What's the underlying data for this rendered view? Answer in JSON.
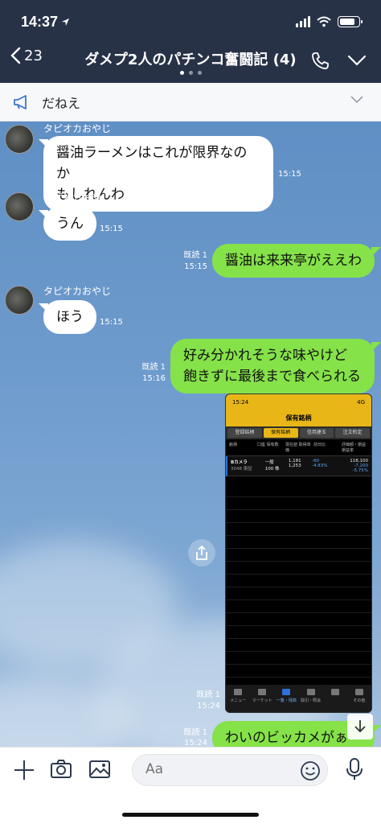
{
  "status": {
    "time": "14:37"
  },
  "header": {
    "back_count": "23",
    "title": "ダメプ2人のパチンコ奮闘記 (4)"
  },
  "announcement": {
    "text": "だねえ"
  },
  "messages": [
    {
      "sender": "タピオカおやじ",
      "text_lines": [
        "醤油ラーメンはこれが限界なのか",
        "もしれんわ"
      ],
      "time": "15:15"
    },
    {
      "sender": "タピオカおやじ",
      "text": "うん",
      "time": "15:15"
    },
    {
      "read": "既読 1",
      "time": "15:15",
      "text": "醤油は来来亭がええわ"
    },
    {
      "sender": "タピオカおやじ",
      "text": "ほう",
      "time": "15:15"
    },
    {
      "read": "既読 1",
      "time": "15:16",
      "text_lines": [
        "好み分かれそうな味やけど",
        "飽きずに最後まで食べられる"
      ]
    },
    {
      "read": "既読 1",
      "time": "15:24"
    },
    {
      "read": "既読 1",
      "time": "15:24",
      "text": "わいのビッカメがぁ"
    }
  ],
  "stock_screenshot": {
    "status_time": "15:24",
    "status_net": "4G",
    "title": "保有銘柄",
    "tabs": [
      "登録銘柄",
      "保有銘柄",
      "信用建玉",
      "注文約定"
    ],
    "columns": [
      "銘柄",
      "口座 保有数",
      "現在値 取得単価",
      "前日比",
      "評価額・損益 損益率"
    ],
    "row": {
      "name": "Bカメラ",
      "sub": "3048 東証",
      "account": "一般",
      "qty": "100 株",
      "price": "1,181",
      "cost": "1,253",
      "change": "-60",
      "change_pct": "-4.83%",
      "value": "118,100",
      "pl": "-7,200",
      "pl_pct": "-5.75%"
    },
    "tabbar": [
      "メニュー",
      "マーケット",
      "一覧・残高",
      "取引・照会",
      "",
      "その他"
    ]
  },
  "input": {
    "placeholder": "Aa"
  },
  "colors": {
    "header": "#273247",
    "out_bubble": "#85e249",
    "in_bubble": "#ffffff"
  }
}
